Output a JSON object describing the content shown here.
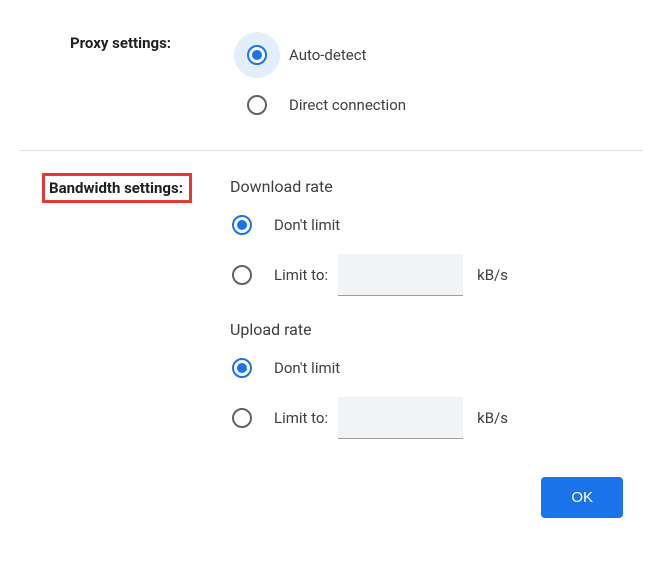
{
  "proxy": {
    "label": "Proxy settings:",
    "auto": "Auto-detect",
    "direct": "Direct connection"
  },
  "bandwidth": {
    "label": "Bandwidth settings:",
    "download": {
      "heading": "Download rate",
      "dontLimit": "Don't limit",
      "limitTo": "Limit to:",
      "unit": "kB/s",
      "value": ""
    },
    "upload": {
      "heading": "Upload rate",
      "dontLimit": "Don't limit",
      "limitTo": "Limit to:",
      "unit": "kB/s",
      "value": ""
    }
  },
  "footer": {
    "ok": "OK"
  }
}
